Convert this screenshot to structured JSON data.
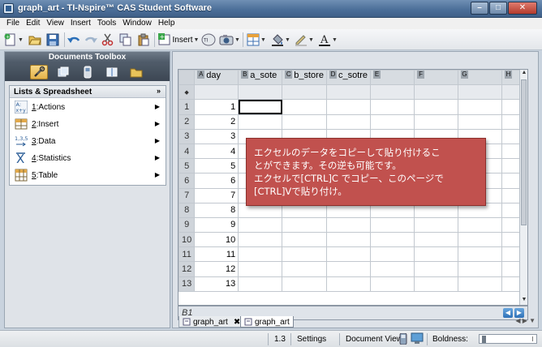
{
  "window": {
    "title": "graph_art - TI-Nspire™ CAS Student Software"
  },
  "menu": [
    "File",
    "Edit",
    "View",
    "Insert",
    "Tools",
    "Window",
    "Help"
  ],
  "toolbar": {
    "insert_label": "Insert"
  },
  "toolbox": {
    "header": "Documents Toolbox",
    "section_title": "Lists & Spreadsheet",
    "items": [
      {
        "num": "1",
        "label": ":Actions",
        "icon": "actions-icon"
      },
      {
        "num": "2",
        "label": ":Insert",
        "icon": "insert-icon"
      },
      {
        "num": "3",
        "label": ":Data",
        "icon": "data-icon"
      },
      {
        "num": "4",
        "label": ":Statistics",
        "icon": "statistics-icon"
      },
      {
        "num": "5",
        "label": ":Table",
        "icon": "table-icon"
      }
    ]
  },
  "sheet": {
    "columns": [
      {
        "letter": "A",
        "name": "day"
      },
      {
        "letter": "B",
        "name": "a_sote"
      },
      {
        "letter": "C",
        "name": "b_store"
      },
      {
        "letter": "D",
        "name": "c_sotre"
      },
      {
        "letter": "E",
        "name": ""
      },
      {
        "letter": "F",
        "name": ""
      },
      {
        "letter": "G",
        "name": ""
      },
      {
        "letter": "H",
        "name": ""
      }
    ],
    "formula_row_marker": "◆",
    "rows": [
      {
        "n": "1",
        "day": "1"
      },
      {
        "n": "2",
        "day": "2"
      },
      {
        "n": "3",
        "day": "3"
      },
      {
        "n": "4",
        "day": "4"
      },
      {
        "n": "5",
        "day": "5"
      },
      {
        "n": "6",
        "day": "6"
      },
      {
        "n": "7",
        "day": "7"
      },
      {
        "n": "8",
        "day": "8"
      },
      {
        "n": "9",
        "day": "9"
      },
      {
        "n": "10",
        "day": "10"
      },
      {
        "n": "11",
        "day": "11"
      },
      {
        "n": "12",
        "day": "12"
      },
      {
        "n": "13",
        "day": "13"
      }
    ],
    "cell_ref": "B1"
  },
  "note": {
    "lines": [
      "エクセルのデータをコピーして貼り付けるこ",
      "とができます。その逆も可能です。",
      "エクセルで[CTRL]C でコピー、このページで",
      "[CTRL]Vで貼り付け。"
    ]
  },
  "tabs": [
    {
      "label": "graph_art",
      "close": "✖"
    },
    {
      "label": "graph_art",
      "close": ""
    }
  ],
  "status": {
    "page": "1.3",
    "settings": "Settings",
    "document_view": "Document View:",
    "boldness": "Boldness:"
  }
}
